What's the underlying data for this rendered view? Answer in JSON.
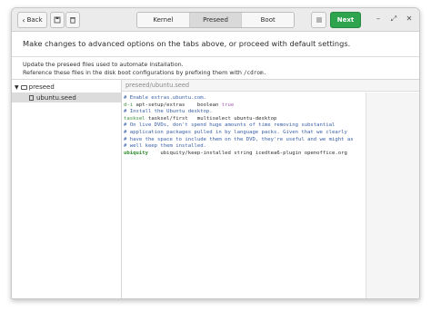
{
  "header": {
    "back_label": "Back",
    "tabs": [
      {
        "label": "Kernel",
        "active": false
      },
      {
        "label": "Preseed",
        "active": true
      },
      {
        "label": "Boot",
        "active": false
      }
    ],
    "next_label": "Next",
    "next_color": "#2ea44f"
  },
  "intro": "Make changes to advanced options on the tabs above, or proceed with default settings.",
  "hint": {
    "line1": "Update the preseed files used to automate installation.",
    "line2_prefix": "Reference these files in the disk boot configurations by prefixing them with",
    "line2_code": "/cdrom."
  },
  "tree": {
    "folder": "preseed",
    "file": "ubuntu.seed"
  },
  "editor": {
    "path": "preseed/ubuntu.seed",
    "lines": {
      "l1": "# Enable extras.ubuntu.com.",
      "l2_owner": "d-i",
      "l2_rest": " apt-setup/extras    boolean ",
      "l2_value": "true",
      "l3": "# Install the Ubuntu desktop.",
      "l4_owner": "tasksel",
      "l4_rest": " tasksel/first   multiselect ubuntu-desktop",
      "l5": "# On live DVDs, don't spend huge amounts of time removing substantial",
      "l6": "# application packages pulled in by language packs. Given that we clearly",
      "l7": "# have the space to include them on the DVD, they're useful and we might as",
      "l8": "# well keep them installed.",
      "l9_owner": "ubiquity",
      "l9_rest": "    ubiquity/keep-installed string icedtea6-plugin openoffice.org"
    }
  },
  "colors": {
    "comment": "#3a60a8",
    "owner": "#3c8f3c",
    "boolean": "#a45bb0"
  }
}
